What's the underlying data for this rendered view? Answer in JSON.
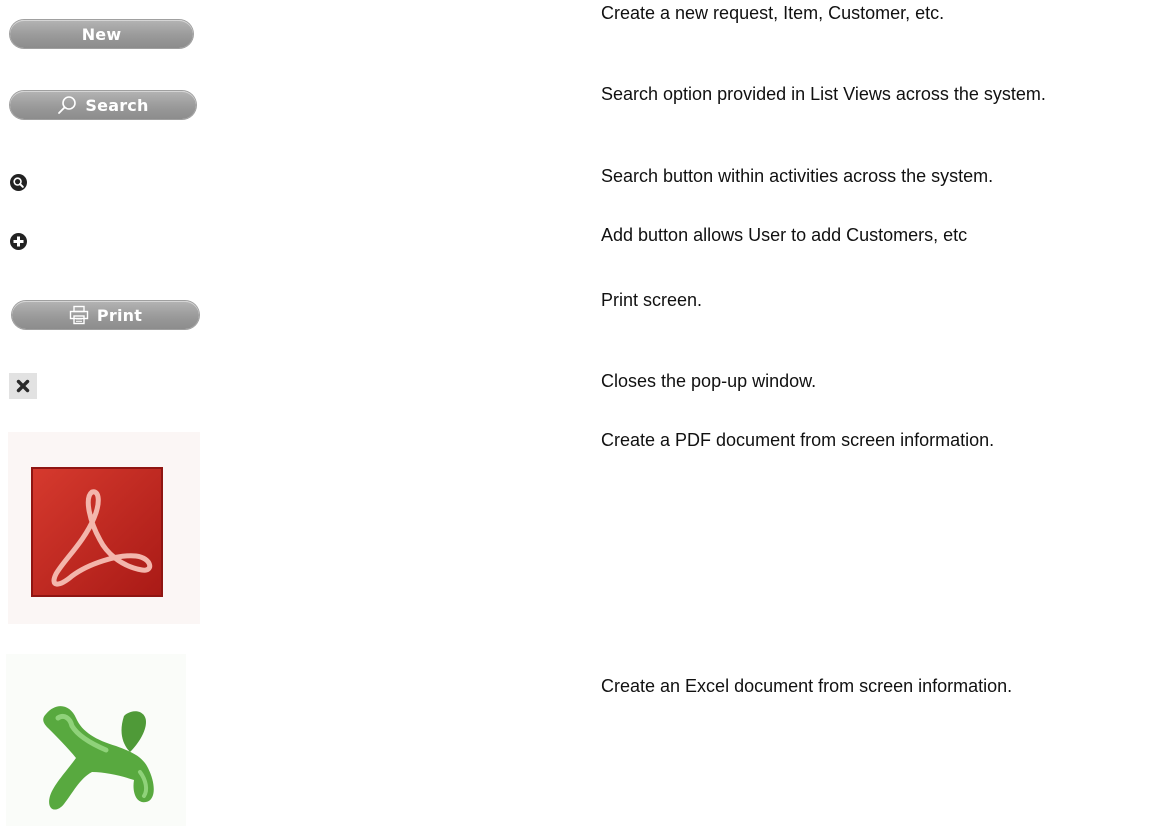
{
  "buttons": {
    "new_label": "New",
    "search_label": "Search",
    "print_label": "Print"
  },
  "icons": {
    "magnifier": "search-icon",
    "add": "add-icon",
    "close": "close-icon",
    "pdf": "pdf-icon",
    "excel": "excel-icon"
  },
  "descriptions": {
    "new": "Create a new request, Item, Customer, etc.",
    "search": "Search option provided in List Views across the system.",
    "magnifier": "Search button within activities across the system.",
    "add": "Add button allows User to add Customers, etc",
    "print": "Print screen.",
    "close": "Closes the pop-up window.",
    "pdf": "Create a PDF document from screen information.",
    "excel": "Create an Excel document from screen information."
  },
  "colors": {
    "button_gray": "#9a9a9a",
    "pdf_red": "#c62a22",
    "excel_green": "#4ea63a"
  }
}
